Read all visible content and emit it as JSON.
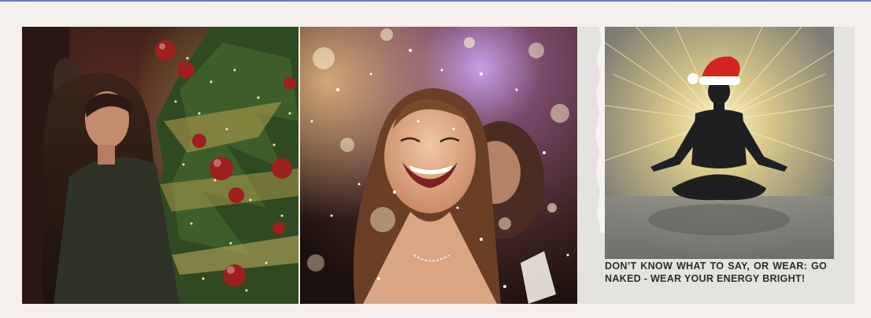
{
  "colors": {
    "accent_bar": "#6b78d6",
    "page_bg": "#f4f1ed",
    "card_bg": "#e5e3df",
    "caption_text": "#2b2b2b"
  },
  "panels": [
    {
      "image": "christmas-tree-woman-illustration"
    },
    {
      "image": "laughing-woman-party-bokeh-illustration"
    },
    {
      "image": "meditating-silhouette-santa-hat-illustration",
      "caption": "DON’T KNOW WHAT TO SAY, OR WEAR: GO NAKED - WEAR YOUR ENERGY BRIGHT!"
    }
  ]
}
